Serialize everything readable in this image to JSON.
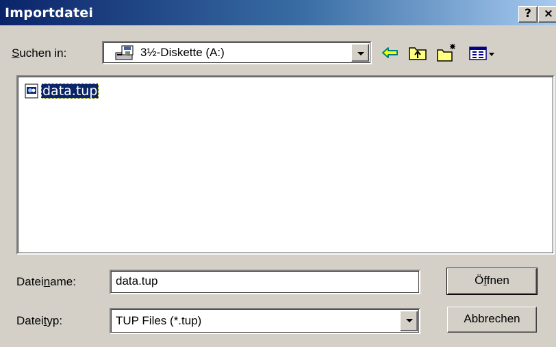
{
  "window": {
    "title": "Importdatei",
    "help_label": "?",
    "close_label": "×"
  },
  "look_in": {
    "label_pre": "",
    "label_accel": "S",
    "label_post": "uchen in:",
    "value": "3½-Diskette (A:)",
    "icon": "floppy-drive-icon"
  },
  "toolbar": {
    "back_icon": "back-arrow-icon",
    "up_icon": "up-folder-icon",
    "new_folder_icon": "new-folder-icon",
    "view_menu_icon": "view-menu-icon"
  },
  "files": [
    {
      "name": "data.tup",
      "icon": "tup-file-icon",
      "selected": true
    }
  ],
  "file_name": {
    "label_pre": "Datei",
    "label_accel": "n",
    "label_post": "ame:",
    "value": "data.tup"
  },
  "file_type": {
    "label_pre": "Datei",
    "label_accel": "t",
    "label_post": "yp:",
    "value": "TUP Files (*.tup)"
  },
  "buttons": {
    "open_pre": "Ö",
    "open_accel": "f",
    "open_post": "fnen",
    "cancel": "Abbrechen"
  },
  "colors": {
    "dialog_bg": "#d4d0c8",
    "title_active": "#0a246a",
    "selection": "#0a246a"
  }
}
